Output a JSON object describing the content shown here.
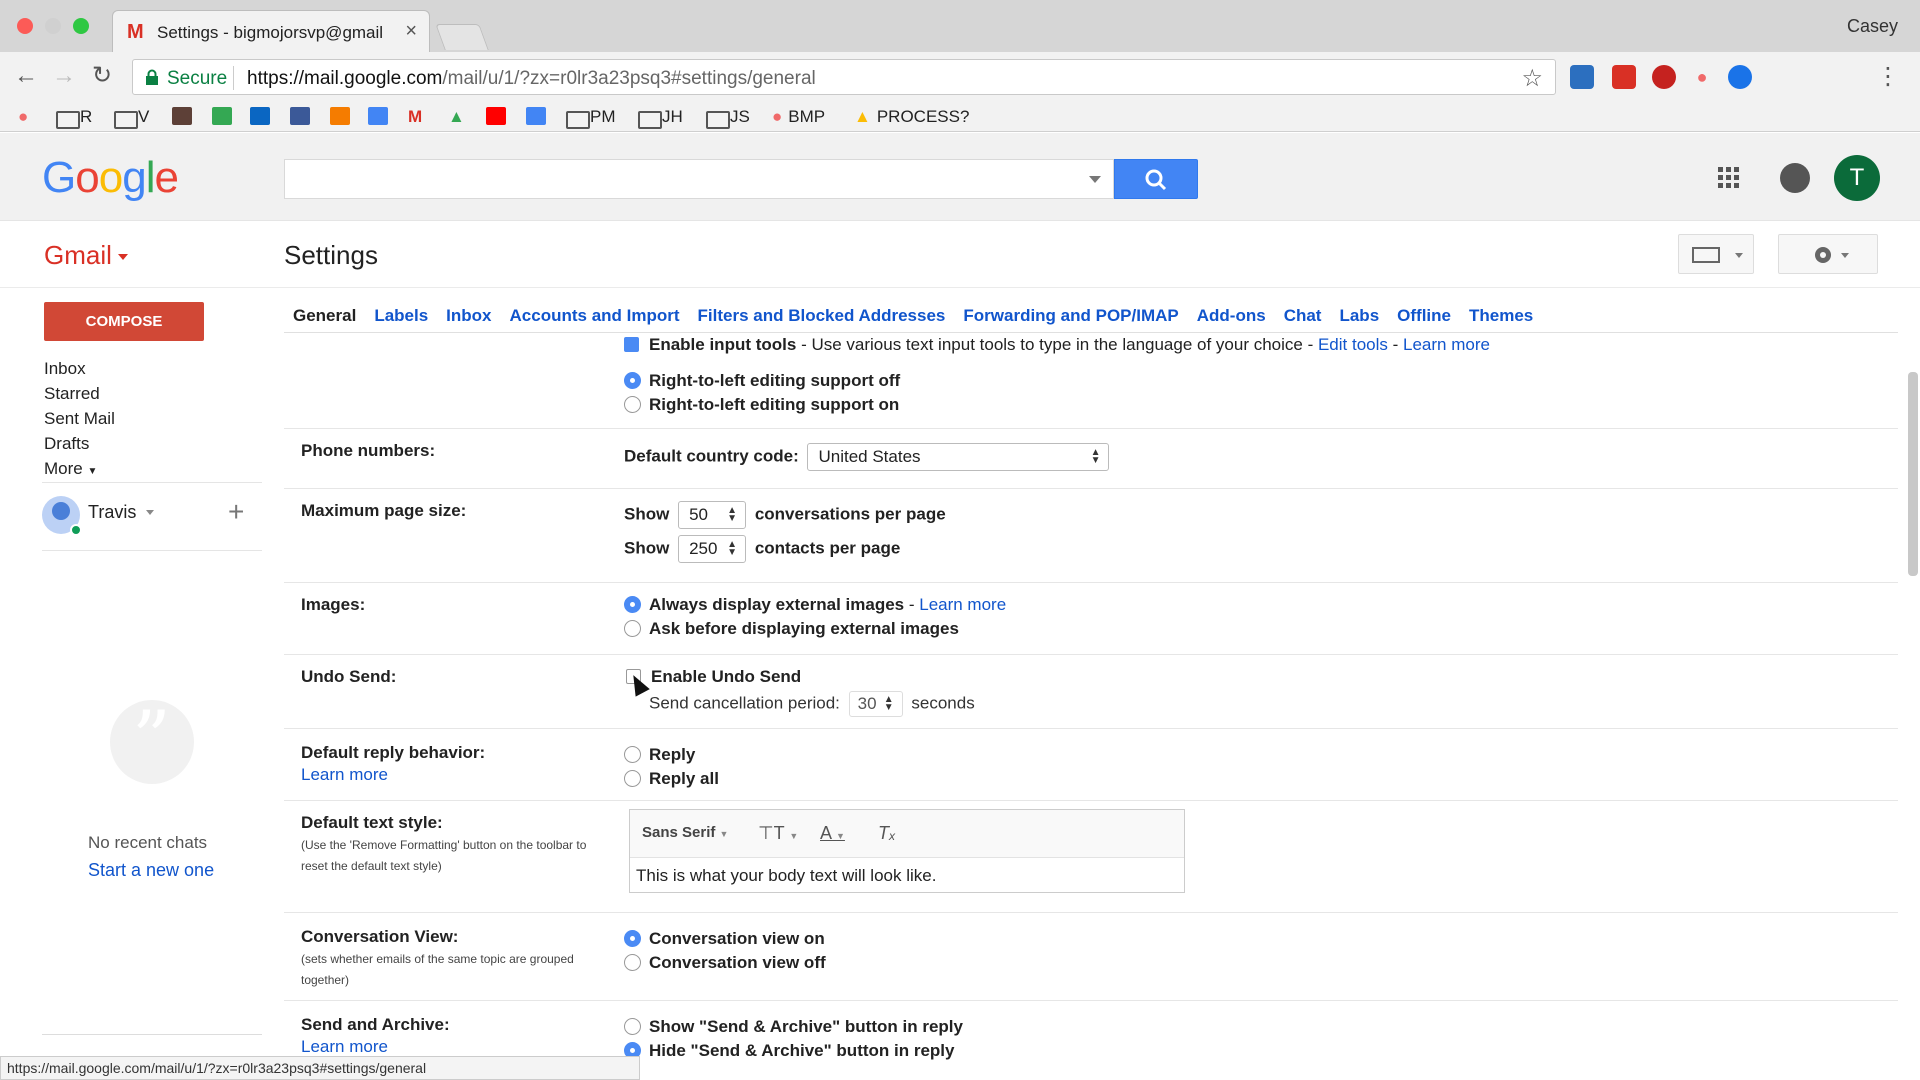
{
  "browser": {
    "tab_favicon": "M",
    "tab_title": "Settings - bigmojorsvp@gmail",
    "tab_close": "×",
    "profile": "Casey",
    "secure_label": "Secure",
    "url_host": "https://mail.google.com",
    "url_path": "/mail/u/1/?zx=r0lr3a23psq3#settings/general",
    "bookmarks": [
      {
        "label": "R",
        "icon": "folder-icon"
      },
      {
        "label": "V",
        "icon": "folder-icon"
      },
      {
        "label": "PM",
        "icon": "folder-icon"
      },
      {
        "label": "JH",
        "icon": "folder-icon"
      },
      {
        "label": "JS",
        "icon": "folder-icon"
      },
      {
        "label": "BMP",
        "icon": "asana-icon"
      },
      {
        "label": "PROCESS?",
        "icon": "drive-icon"
      }
    ],
    "status_url": "https://mail.google.com/mail/u/1/?zx=r0lr3a23psq3#settings/general"
  },
  "header": {
    "logo": [
      "G",
      "o",
      "o",
      "g",
      "l",
      "e"
    ],
    "logo_colors": [
      "#4285f4",
      "#ea4335",
      "#fbbc05",
      "#4285f4",
      "#34a853",
      "#ea4335"
    ],
    "avatar_letter": "T"
  },
  "sub": {
    "gmail_label": "Gmail",
    "settings_title": "Settings"
  },
  "nav": {
    "compose": "COMPOSE",
    "items": [
      "Inbox",
      "Starred",
      "Sent Mail",
      "Drafts",
      "More"
    ],
    "user": "Travis",
    "no_chats": "No recent chats",
    "start_new": "Start a new one"
  },
  "tabs": [
    "General",
    "Labels",
    "Inbox",
    "Accounts and Import",
    "Filters and Blocked Addresses",
    "Forwarding and POP/IMAP",
    "Add-ons",
    "Chat",
    "Labs",
    "Offline",
    "Themes"
  ],
  "settings": {
    "input_tools": {
      "label": "Enable input tools",
      "desc": " - Use various text input tools to type in the language of your choice - ",
      "edit": "Edit tools",
      "sep": " - ",
      "learn": "Learn more"
    },
    "rtl_off": "Right-to-left editing support off",
    "rtl_on": "Right-to-left editing support on",
    "phone": {
      "label": "Phone numbers:",
      "country_label": "Default country code:",
      "country_value": "United States"
    },
    "page_size": {
      "label": "Maximum page size:",
      "show": "Show",
      "conv_value": "50",
      "conv_suffix": "conversations per page",
      "contacts_value": "250",
      "contacts_suffix": "contacts per page"
    },
    "images": {
      "label": "Images:",
      "always": "Always display external images",
      "sep": " - ",
      "learn": "Learn more",
      "ask": "Ask before displaying external images"
    },
    "undo": {
      "label": "Undo Send:",
      "enable": "Enable Undo Send",
      "period_label": "Send cancellation period:",
      "period_value": "30",
      "seconds": "seconds"
    },
    "reply": {
      "label": "Default reply behavior:",
      "learn": "Learn more",
      "reply": "Reply",
      "reply_all": "Reply all"
    },
    "text_style": {
      "label": "Default text style:",
      "note": "(Use the 'Remove Formatting' button on the toolbar to reset the default text style)",
      "font": "Sans Serif",
      "sample": "This is what your body text will look like."
    },
    "conversation": {
      "label": "Conversation View:",
      "note": "(sets whether emails of the same topic are grouped together)",
      "on": "Conversation view on",
      "off": "Conversation view off"
    },
    "send_archive": {
      "label": "Send and Archive:",
      "learn": "Learn more",
      "show": "Show \"Send & Archive\" button in reply",
      "hide": "Hide \"Send & Archive\" button in reply"
    }
  },
  "colors": {
    "accent_blue": "#4285f4",
    "link": "#1155cc",
    "compose_red": "#d14836"
  }
}
